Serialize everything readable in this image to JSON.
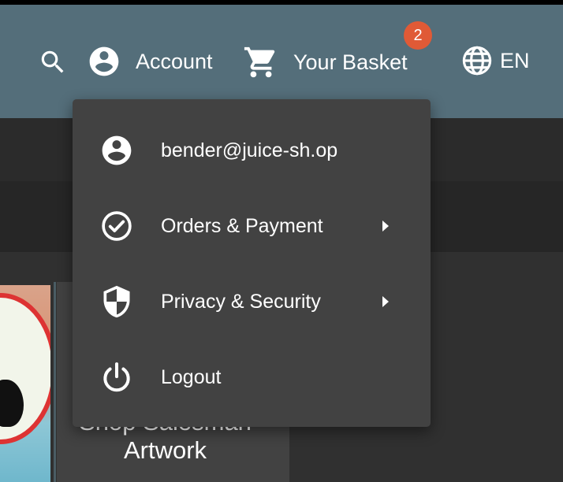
{
  "header": {
    "account_label": "Account",
    "basket_label": "Your Basket",
    "basket_count": "2",
    "language_label": "EN",
    "icons": [
      "search-icon",
      "account-circle-icon",
      "shopping-cart-icon",
      "globe-icon"
    ]
  },
  "account_menu": {
    "items": [
      {
        "label": "bender@juice-sh.op",
        "icon": "account-circle-icon",
        "has_submenu": false
      },
      {
        "label": "Orders & Payment",
        "icon": "check-circle-icon",
        "has_submenu": true
      },
      {
        "label": "Privacy & Security",
        "icon": "security-shield-icon",
        "has_submenu": true
      },
      {
        "label": "Logout",
        "icon": "power-icon",
        "has_submenu": false
      }
    ]
  },
  "background": {
    "product_title": "Shop Salesman Artwork"
  },
  "colors": {
    "toolbar": "#546e7a",
    "menu_bg": "#424242",
    "page_bg": "#303030",
    "badge": "#e05a36"
  }
}
